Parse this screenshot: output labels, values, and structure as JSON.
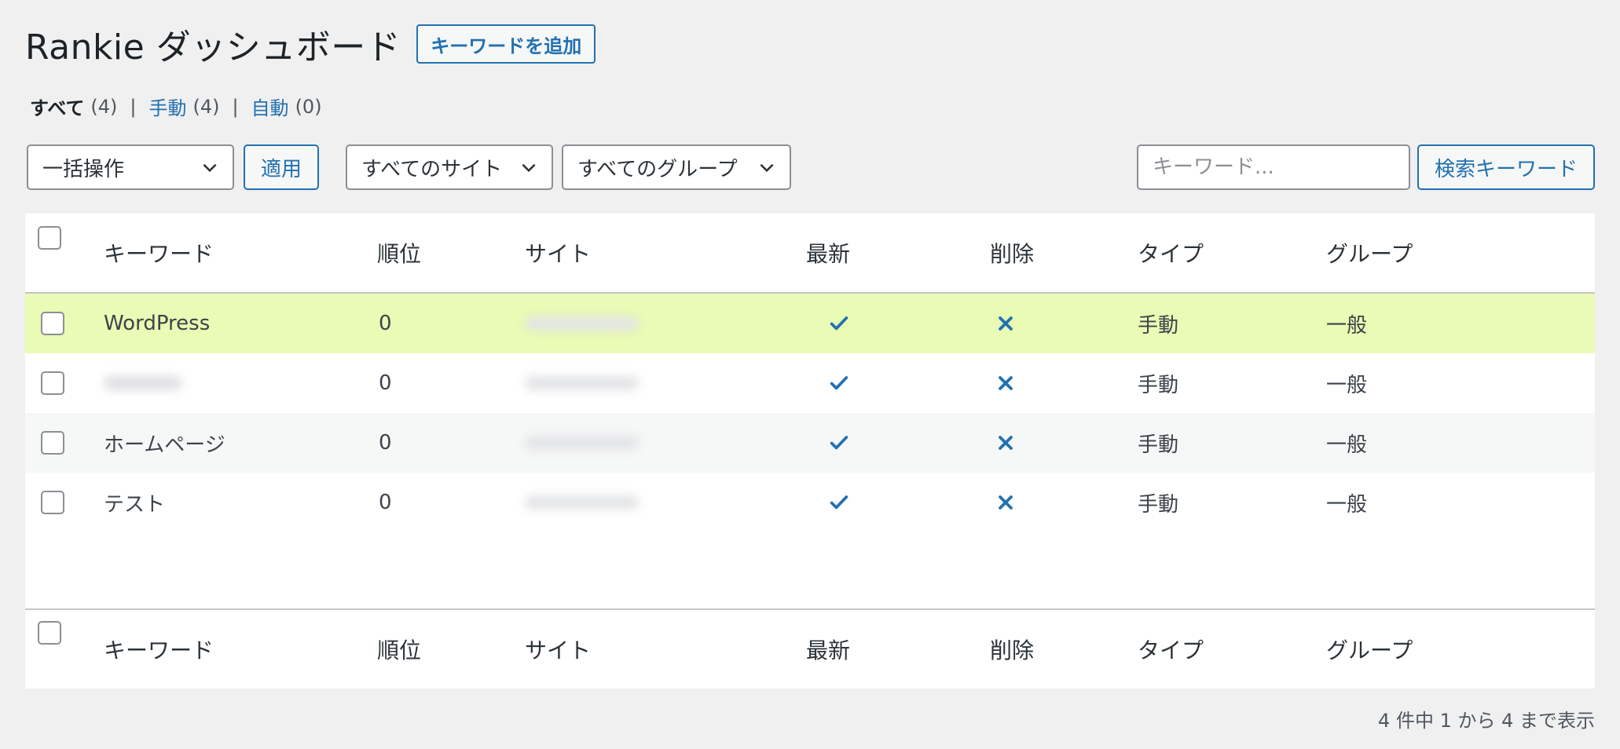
{
  "header": {
    "title": "Rankie ダッシュボード",
    "add_button": "キーワードを追加"
  },
  "views": {
    "all": {
      "label": "すべて",
      "count": "(4)"
    },
    "manual": {
      "label": "手動",
      "count": "(4)"
    },
    "auto": {
      "label": "自動",
      "count": "(0)"
    },
    "separator": "|"
  },
  "toolbar": {
    "bulk_action": "一括操作",
    "apply": "適用",
    "site_filter": "すべてのサイト",
    "group_filter": "すべてのグループ",
    "search_placeholder": "キーワード...",
    "search_button": "検索キーワード"
  },
  "table": {
    "columns": [
      "キーワード",
      "順位",
      "サイト",
      "最新",
      "削除",
      "タイプ",
      "グループ"
    ],
    "rows": [
      {
        "keyword": "WordPress",
        "rank": "0",
        "site": "",
        "type": "手動",
        "group": "一般"
      },
      {
        "keyword": "",
        "rank": "0",
        "site": "",
        "type": "手動",
        "group": "一般"
      },
      {
        "keyword": "ホームページ",
        "rank": "0",
        "site": "",
        "type": "手動",
        "group": "一般"
      },
      {
        "keyword": "テスト",
        "rank": "0",
        "site": "",
        "type": "手動",
        "group": "一般"
      }
    ],
    "footer_count": "4 件中 1 から 4 まで表示"
  },
  "colors": {
    "accent": "#2271b1",
    "highlight": "#e9fbb4",
    "background": "#f0f0f1"
  },
  "icons": {
    "latest": "checkmark-icon",
    "delete": "close-icon",
    "dropdown": "chevron-down-icon"
  }
}
